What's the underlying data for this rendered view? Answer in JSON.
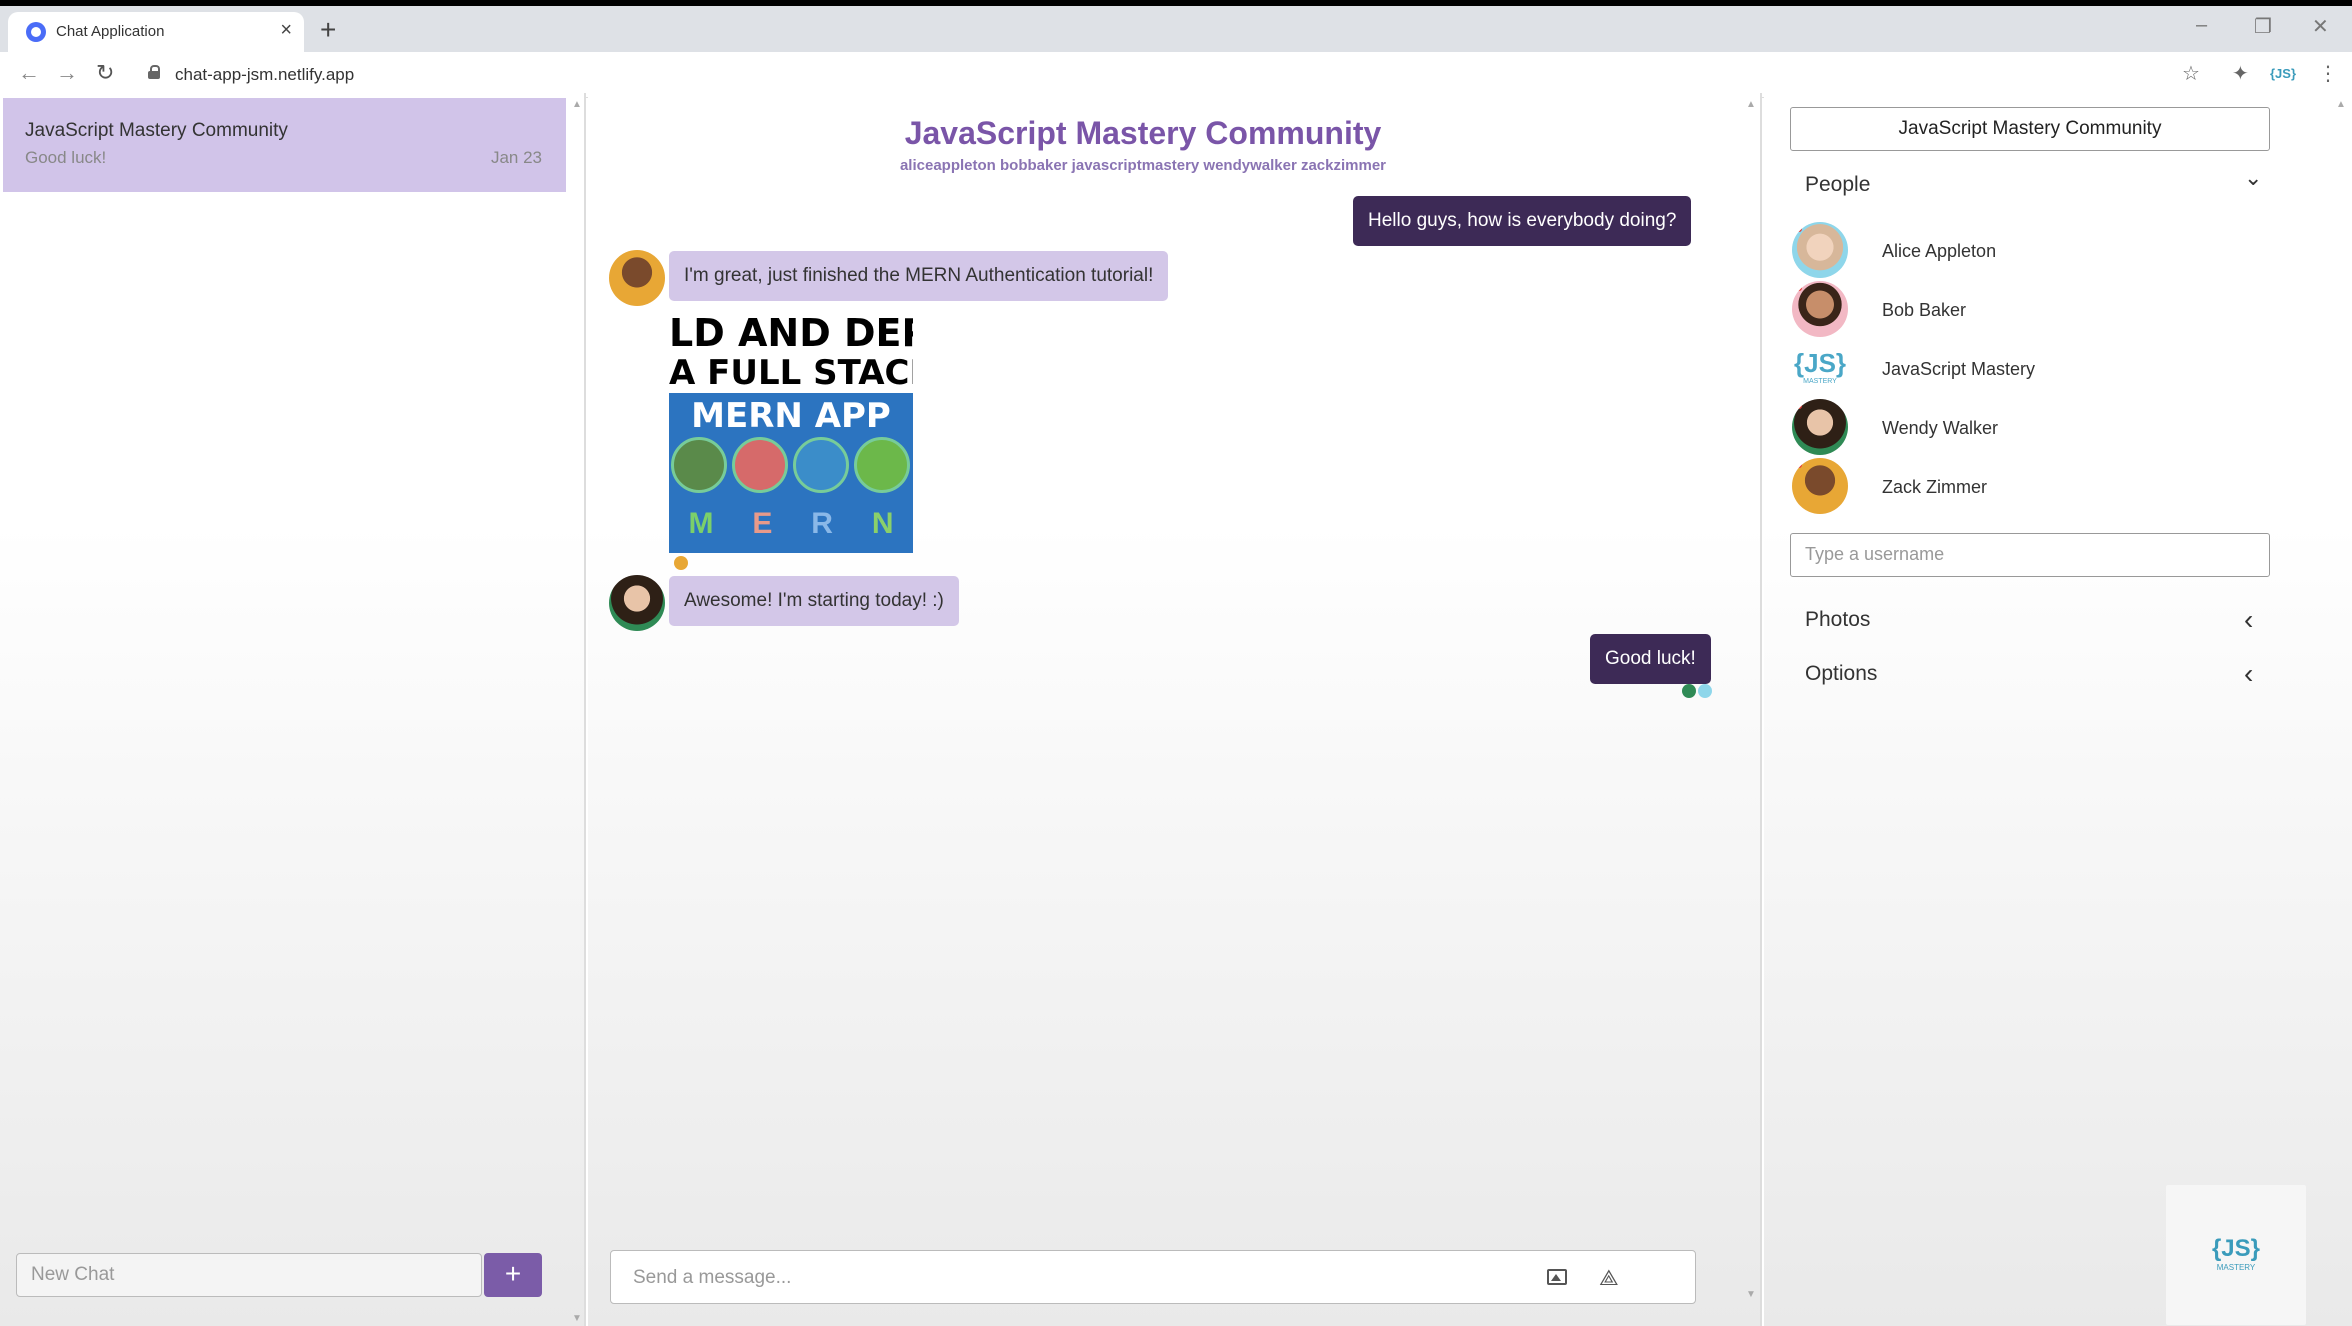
{
  "browser": {
    "tab_title": "Chat Application",
    "new_tab": "+",
    "close_tab": "×",
    "url": "chat-app-jsm.netlify.app",
    "nav": {
      "back": "←",
      "forward": "→",
      "reload": "↻"
    },
    "window": {
      "minimize": "–",
      "restore": "❐",
      "close": "✕"
    },
    "toolbar_icons": {
      "star": "☆",
      "extensions": "✦",
      "menu": "⋮"
    }
  },
  "sidebar": {
    "chats": [
      {
        "title": "JavaScript Mastery Community",
        "last_message": "Good luck!",
        "date": "Jan 23"
      }
    ],
    "new_chat_placeholder": "New Chat",
    "new_chat_button": "+"
  },
  "chat": {
    "title": "JavaScript Mastery Community",
    "members": "aliceappleton bobbaker javascriptmastery wendywalker zackzimmer",
    "messages": [
      {
        "sender": "me",
        "text": "Hello guys, how is everybody doing?"
      },
      {
        "sender": "zackzimmer",
        "text": "I'm great, just finished the MERN Authentication tutorial!",
        "avatar": "zack-avatar"
      },
      {
        "sender": "zackzimmer",
        "attachment": {
          "lines": [
            "LD AND DEPL",
            "A FULL STACK",
            "MERN APP"
          ],
          "letters": [
            "M",
            "E",
            "R",
            "N"
          ],
          "icons": [
            "mongodb-icon",
            "express-icon",
            "react-icon",
            "nodejs-icon"
          ]
        }
      },
      {
        "sender": "wendywalker",
        "text": "Awesome! I'm starting today! :)",
        "avatar": "wendy-avatar"
      },
      {
        "sender": "me",
        "text": "Good luck!"
      }
    ],
    "input_placeholder": "Send a message...",
    "input_icons": [
      "image-upload-icon",
      "send-icon"
    ],
    "send_glyph": "⟁"
  },
  "settings": {
    "chat_title": "JavaScript Mastery Community",
    "people_label": "People",
    "people_chevron": "⌄",
    "people": [
      {
        "name": "Alice Appleton",
        "avatar": "alice-avatar"
      },
      {
        "name": "Bob Baker",
        "avatar": "bob-avatar"
      },
      {
        "name": "JavaScript Mastery",
        "avatar": "jsm-logo"
      },
      {
        "name": "Wendy Walker",
        "avatar": "wendy-avatar"
      },
      {
        "name": "Zack Zimmer",
        "avatar": "zack-avatar"
      }
    ],
    "username_placeholder": "Type a username",
    "photos_label": "Photos",
    "photos_chevron": "‹",
    "options_label": "Options",
    "options_chevron": "‹"
  },
  "logo": {
    "mark": "{JS}",
    "sub": "MASTERY"
  },
  "colors": {
    "accent": "#7a55a8",
    "my_bubble": "#3d2a56",
    "their_bubble": "#d3c7e8",
    "active_chat": "#d1c4e9",
    "button": "#7b5ca8"
  }
}
